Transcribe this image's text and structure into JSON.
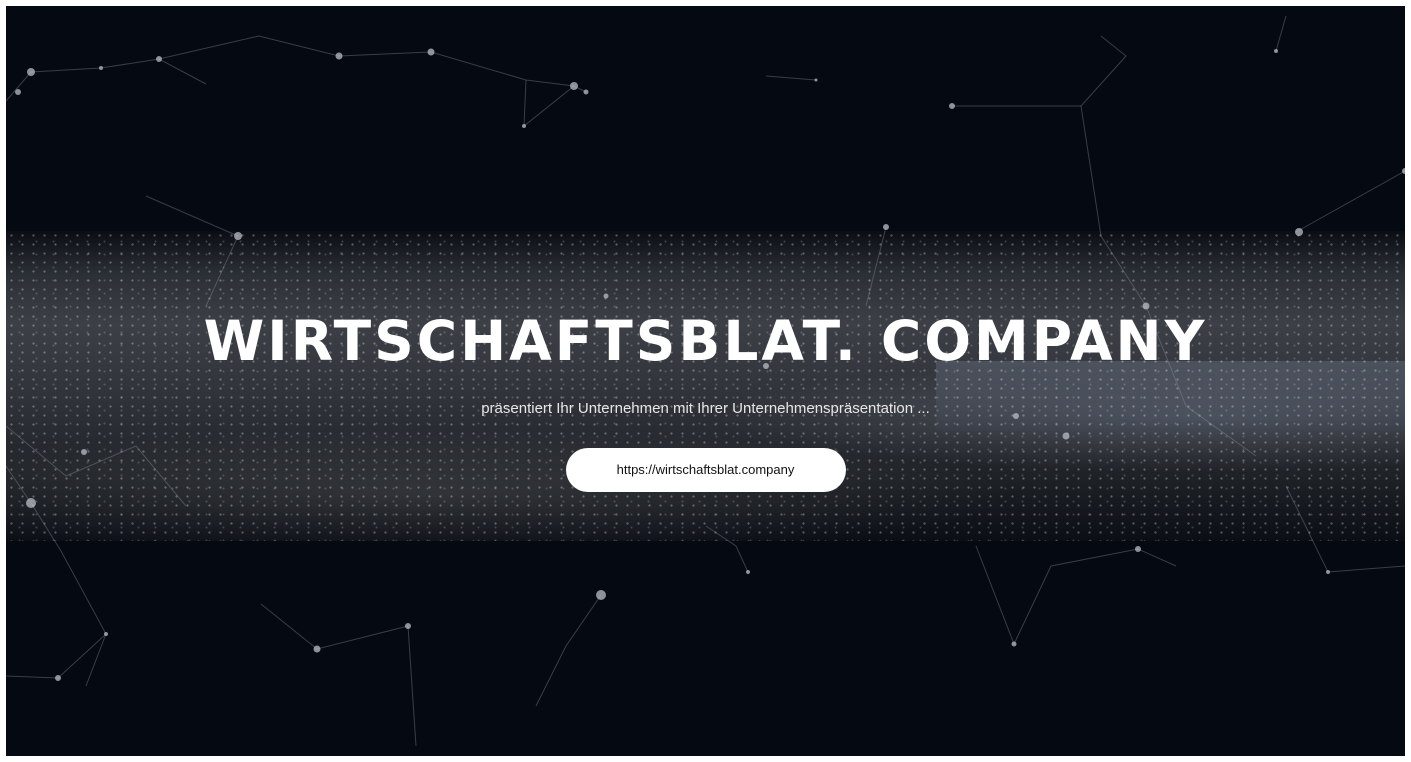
{
  "hero": {
    "title": "WIRTSCHAFTSBLAT. COMPANY",
    "subtitle": "präsentiert Ihr Unternehmen mit Ihrer Unternehmenspräsentation ...",
    "button_label": "https://wirtschaftsblat.company"
  },
  "colors": {
    "background": "#050911",
    "title": "#ffffff",
    "button_bg": "#ffffff",
    "button_text": "#111111"
  }
}
